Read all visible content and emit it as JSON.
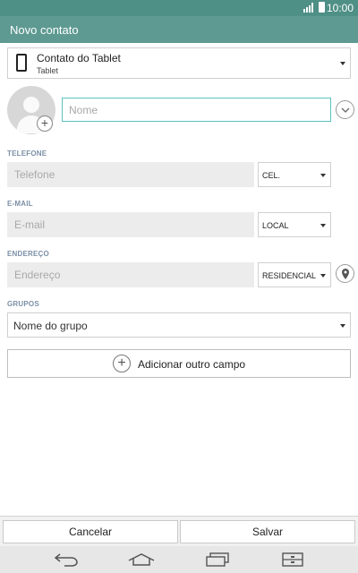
{
  "status_bar": {
    "time": "10:00"
  },
  "title_bar": {
    "title": "Novo contato"
  },
  "account": {
    "name": "Contato do Tablet",
    "type": "Tablet"
  },
  "name_field": {
    "placeholder": "Nome"
  },
  "phone": {
    "label": "TELEFONE",
    "placeholder": "Telefone",
    "type": "CEL."
  },
  "email": {
    "label": "E-MAIL",
    "placeholder": "E-mail",
    "type": "LOCAL"
  },
  "address": {
    "label": "ENDEREÇO",
    "placeholder": "Endereço",
    "type": "RESIDENCIAL"
  },
  "groups": {
    "label": "GRUPOS",
    "value": "Nome do grupo"
  },
  "add_field": {
    "label": "Adicionar outro campo"
  },
  "actions": {
    "cancel": "Cancelar",
    "save": "Salvar"
  },
  "icons": {
    "status": [
      "signal-icon",
      "battery-icon"
    ],
    "account": "tablet-device-icon",
    "avatar": "contact-avatar-icon",
    "expand": "chevron-down-icon",
    "address": "location-pin-icon",
    "add": "plus-icon",
    "nav": [
      "back-icon",
      "home-icon",
      "recent-apps-icon",
      "menu-icon"
    ]
  },
  "colors": {
    "status_bar": "#4e8f86",
    "title_bar": "#5e9a92",
    "focus": "#5bc2c0",
    "section_label": "#7b8fa6"
  }
}
